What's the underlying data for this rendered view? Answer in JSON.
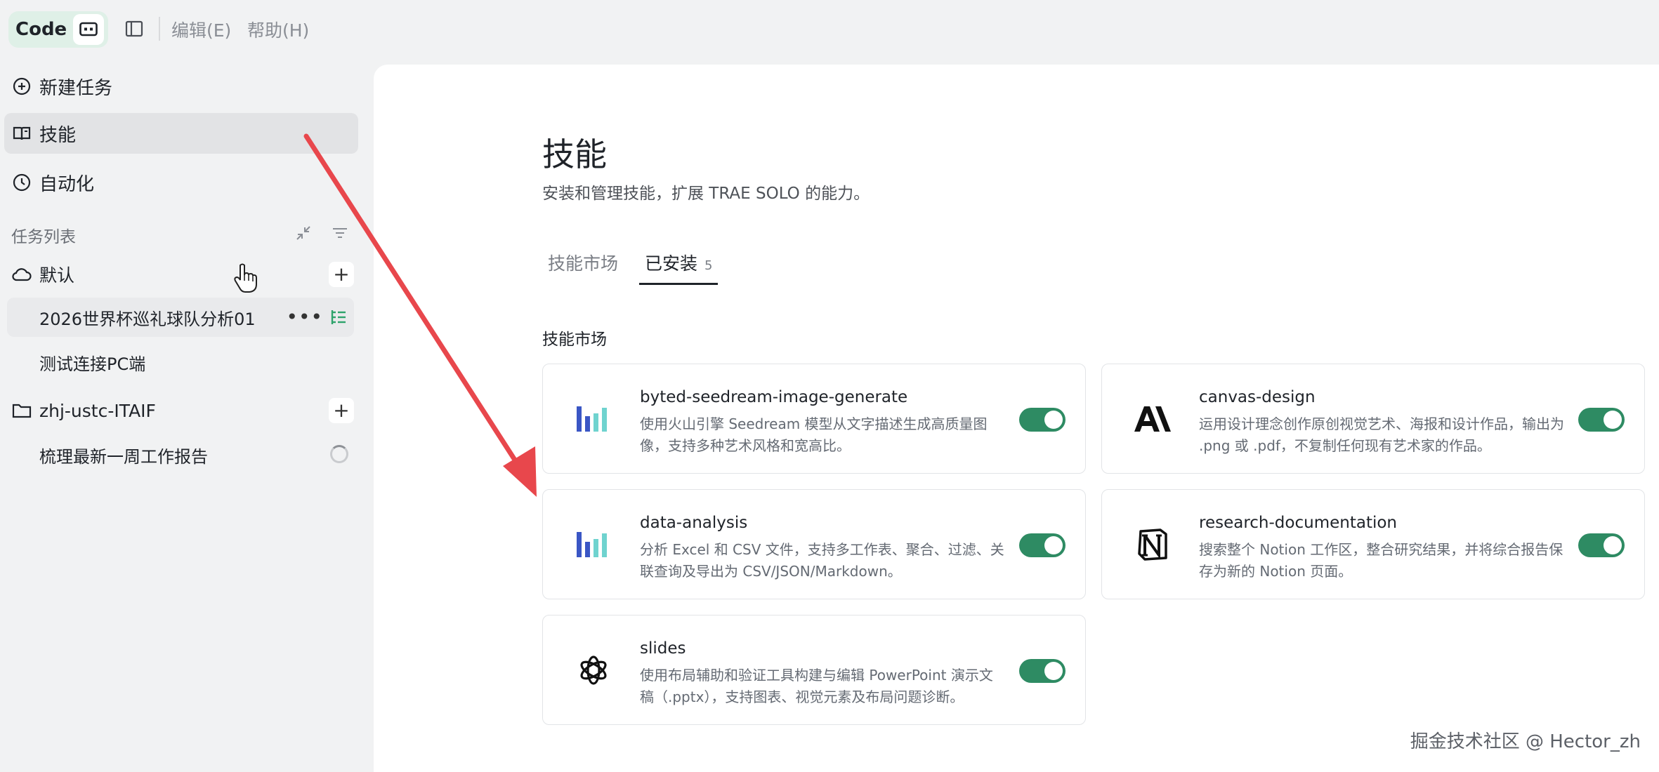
{
  "topbar": {
    "code_label": "Code",
    "menu": [
      "编辑(E)",
      "帮助(H)"
    ]
  },
  "sidebar": {
    "nav": [
      {
        "label": "新建任务",
        "icon": "plus-circle-icon"
      },
      {
        "label": "技能",
        "icon": "book-icon",
        "active": true
      },
      {
        "label": "自动化",
        "icon": "clock-icon"
      }
    ],
    "task_list_title": "任务列表",
    "groups": [
      {
        "name": "默认",
        "icon": "cloud-icon",
        "tasks": [
          "2026世界杯巡礼球队分析01",
          "测试连接PC端"
        ]
      },
      {
        "name": "zhj-ustc-ITAIF",
        "icon": "folder-icon",
        "tasks": [
          "梳理最新一周工作报告"
        ]
      }
    ]
  },
  "main": {
    "title": "技能",
    "subtitle": "安装和管理技能，扩展 TRAE SOLO 的能力。",
    "tabs": [
      {
        "label": "技能市场"
      },
      {
        "label": "已安装",
        "count": "5",
        "active": true
      }
    ],
    "list_title": "技能市场",
    "skills": [
      {
        "name": "byted-seedream-image-generate",
        "desc": "使用火山引擎 Seedream 模型从文字描述生成高质量图像，支持多种艺术风格和宽高比。",
        "icon": "bar-logo-icon",
        "enabled": true
      },
      {
        "name": "canvas-design",
        "desc": "运用设计理念创作原创视觉艺术、海报和设计作品，输出为 .png 或 .pdf，不复制任何现有艺术家的作品。",
        "icon": "anthropic-logo-icon",
        "enabled": true
      },
      {
        "name": "data-analysis",
        "desc": "分析 Excel 和 CSV 文件，支持多工作表、聚合、过滤、关联查询及导出为 CSV/JSON/Markdown。",
        "icon": "bar-logo-icon",
        "enabled": true
      },
      {
        "name": "research-documentation",
        "desc": "搜索整个 Notion 工作区，整合研究结果，并将综合报告保存为新的 Notion 页面。",
        "icon": "notion-logo-icon",
        "enabled": true
      },
      {
        "name": "slides",
        "desc": "使用布局辅助和验证工具构建与编辑 PowerPoint 演示文稿（.pptx），支持图表、视觉元素及布局问题诊断。",
        "icon": "openai-logo-icon",
        "enabled": true
      }
    ]
  },
  "watermark": "掘金技术社区 @ Hector_zh",
  "colors": {
    "accent_green": "#2e8b63",
    "arrow_red": "#e8474c",
    "code_pill_bg": "#dff0e7"
  }
}
